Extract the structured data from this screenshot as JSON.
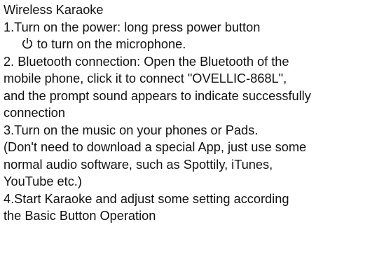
{
  "title": "Wireless Karaoke",
  "steps": {
    "step1_line1": "1.Turn on the power: long press power button",
    "step1_line2": "to turn on the microphone.",
    "step2_line1": "2. Bluetooth connection: Open the Bluetooth of the",
    "step2_line2": "mobile phone, click it to connect \"OVELLIC-868L\",",
    "step2_line3": "and the prompt sound appears to indicate successfully",
    "step2_line4": "connection",
    "step3_line1": "3.Turn on the music on your phones or Pads.",
    "step3_line2": "(Don't need to download a special App, just use some",
    "step3_line3": "normal audio software, such as Spottily, iTunes,",
    "step3_line4": "YouTube etc.)",
    "step4_line1": "4.Start Karaoke and adjust some setting according",
    "step4_line2": "the Basic Button Operation"
  },
  "icons": {
    "power": "power-icon"
  }
}
